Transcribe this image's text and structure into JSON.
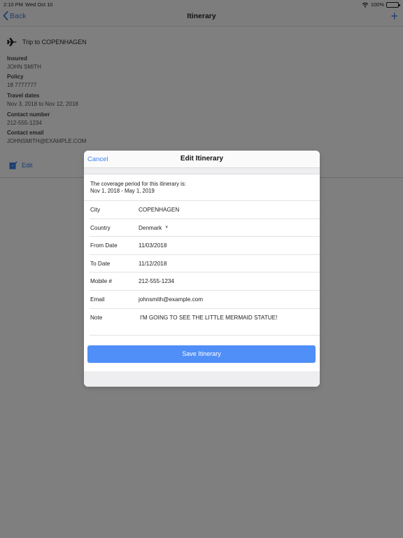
{
  "status": {
    "time": "2:10 PM",
    "date": "Wed Oct 10",
    "battery": "100%"
  },
  "nav": {
    "back_label": "Back",
    "title": "Itinerary",
    "add_label": "+"
  },
  "trip": {
    "title": "Trip to COPENHAGEN"
  },
  "details": [
    {
      "label": "Insured",
      "value": "JOHN SMITH"
    },
    {
      "label": "Policy",
      "value": "18 7777777"
    },
    {
      "label": "Travel dates",
      "value": "Nov 3, 2018 to Nov 12, 2018"
    },
    {
      "label": "Contact number",
      "value": "212-555-1234"
    },
    {
      "label": "Contact email",
      "value": "JOHNSMITH@EXAMPLE.COM"
    }
  ],
  "edit_label": "Edit",
  "modal": {
    "cancel_label": "Cancel",
    "title": "Edit Itinerary",
    "coverage_line1": "The coverage period for this itinerary is:",
    "coverage_line2": "Nov 1, 2018 - May 1, 2019",
    "fields": [
      {
        "label": "City",
        "value": "COPENHAGEN"
      },
      {
        "label": "Country",
        "value": "Denmark"
      },
      {
        "label": "From Date",
        "value": "11/03/2018"
      },
      {
        "label": "To Date",
        "value": "11/12/2018"
      },
      {
        "label": "Mobile #",
        "value": "212-555-1234"
      },
      {
        "label": "Email",
        "value": "johnsmith@example.com"
      },
      {
        "label": "Note",
        "value": "I'M GOING TO SEE THE LITTLE MERMAID STATUE!"
      }
    ],
    "save_label": "Save Itinerary"
  },
  "colors": {
    "accent": "#3b84f6",
    "button": "#4f8ff7",
    "overlay": "#7f7f7f"
  }
}
